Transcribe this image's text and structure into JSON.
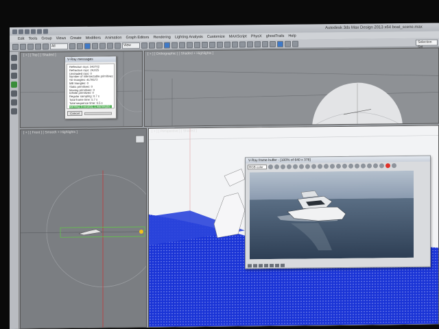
{
  "window": {
    "title": "Autodesk 3ds Max Design 2013 x64     boat_scene.max"
  },
  "menu": [
    "Edit",
    "Tools",
    "Group",
    "Views",
    "Create",
    "Modifiers",
    "Animation",
    "Graph Editors",
    "Rendering",
    "Lighting Analysis",
    "Customize",
    "MAXScript",
    "PhysX",
    "ghostTrails",
    "Help"
  ],
  "toolbar": {
    "selection_filter": "All",
    "reference_coord": "View",
    "named_selection": "Selection Set"
  },
  "viewports": {
    "top_label": "[ + ] [ Top ] [ Shaded ]",
    "front_label": "[ + ] [ Orthographic ] [ Shaded + Highlights ]",
    "left_label": "[ + ] [ Front ] [ Smooth + Highlights ]",
    "persp_label": "[ + ] [ Perspective ] [ Shaded ]"
  },
  "vray_messages": {
    "title": "V-Ray messages",
    "lines": [
      "Reflection rays: 343702",
      "Refraction rays: 24,825",
      "Unshaded rays: 0",
      "Number of intersectable primitives: 4178573",
      "SD triangles: 4178573",
      "MB triangles: 0",
      "Static primitives: 0",
      "Moving primitives: 0",
      "Infinite primitives: 0",
      "Regular sampling: 0.7 s",
      "Total frame time: 5.7 s",
      "Total sequence time: 6.5 s",
      "warning: 0 error(s), 1 warning(s)"
    ],
    "cancel_label": "Cancel"
  },
  "frame_buffer": {
    "title": "V-Ray frame buffer - [100% of 640 x 376]",
    "channel": "RGB color"
  },
  "colors": {
    "viewport_grey": "#8e9195",
    "water_blue": "#1a34d6",
    "highlight_green": "#4caf50",
    "clear_button": "#e0322a"
  }
}
